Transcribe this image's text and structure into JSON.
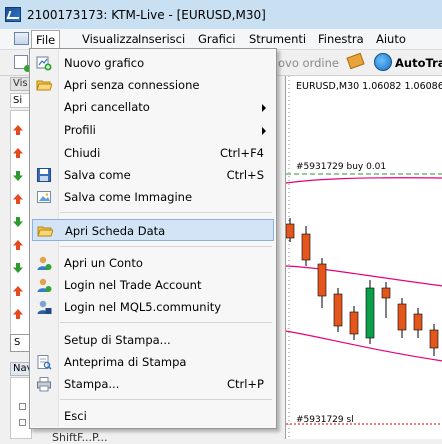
{
  "window": {
    "title": "2100173173: KTM-Live - [EURUSD,M30]"
  },
  "menubar": {
    "items": [
      {
        "label": "File",
        "active": true
      },
      {
        "label": "Visualizza"
      },
      {
        "label": "Inserisci"
      },
      {
        "label": "Grafici"
      },
      {
        "label": "Strumenti"
      },
      {
        "label": "Finestra"
      },
      {
        "label": "Aiuto"
      }
    ]
  },
  "toolbar": {
    "new_order_partial": "ovo ordine",
    "autotrading_partial": "AutoTrac"
  },
  "left_panel": {
    "market_watch_header": "Vis",
    "market_watch_sub": "Si",
    "tabs_label": "S",
    "navigator_header": "Nav",
    "tree_item": "ShiftF...P..."
  },
  "chart": {
    "info": "EURUSD,M30  1.06082 1.06086 1.0",
    "order_buy_label": "#5931729 buy 0.01",
    "order_sl_label": "#5931729 sl",
    "colors": {
      "bull": "#0aa04a",
      "bear": "#e3571e",
      "band": "#e6007e",
      "order": "#2a9a2a",
      "sl": "#d40000"
    }
  },
  "file_menu": {
    "items": [
      {
        "label": "Nuovo grafico",
        "icon": "new-chart-icon"
      },
      {
        "label": "Apri senza connessione",
        "icon": "open-folder-icon"
      },
      {
        "label": "Apri cancellato",
        "submenu": true
      },
      {
        "label": "Profili",
        "submenu": true
      },
      {
        "label": "Chiudi",
        "shortcut": "Ctrl+F4"
      },
      {
        "label": "Salva come",
        "shortcut": "Ctrl+S",
        "icon": "save-icon"
      },
      {
        "label": "Salva come Immagine",
        "icon": "save-image-icon"
      },
      {
        "label": "Apri Scheda Data",
        "highlighted": true,
        "icon": "open-data-folder-icon"
      },
      {
        "label": "Apri un Conto",
        "icon": "open-account-icon"
      },
      {
        "label": "Login nel Trade Account",
        "icon": "login-trade-icon"
      },
      {
        "label": "Login nel MQL5.community",
        "icon": "mql5-login-icon"
      },
      {
        "label": "Setup di Stampa..."
      },
      {
        "label": "Anteprima di Stampa",
        "icon": "print-preview-icon"
      },
      {
        "label": "Stampa...",
        "shortcut": "Ctrl+P",
        "icon": "print-icon"
      },
      {
        "label": "Esci"
      }
    ]
  }
}
